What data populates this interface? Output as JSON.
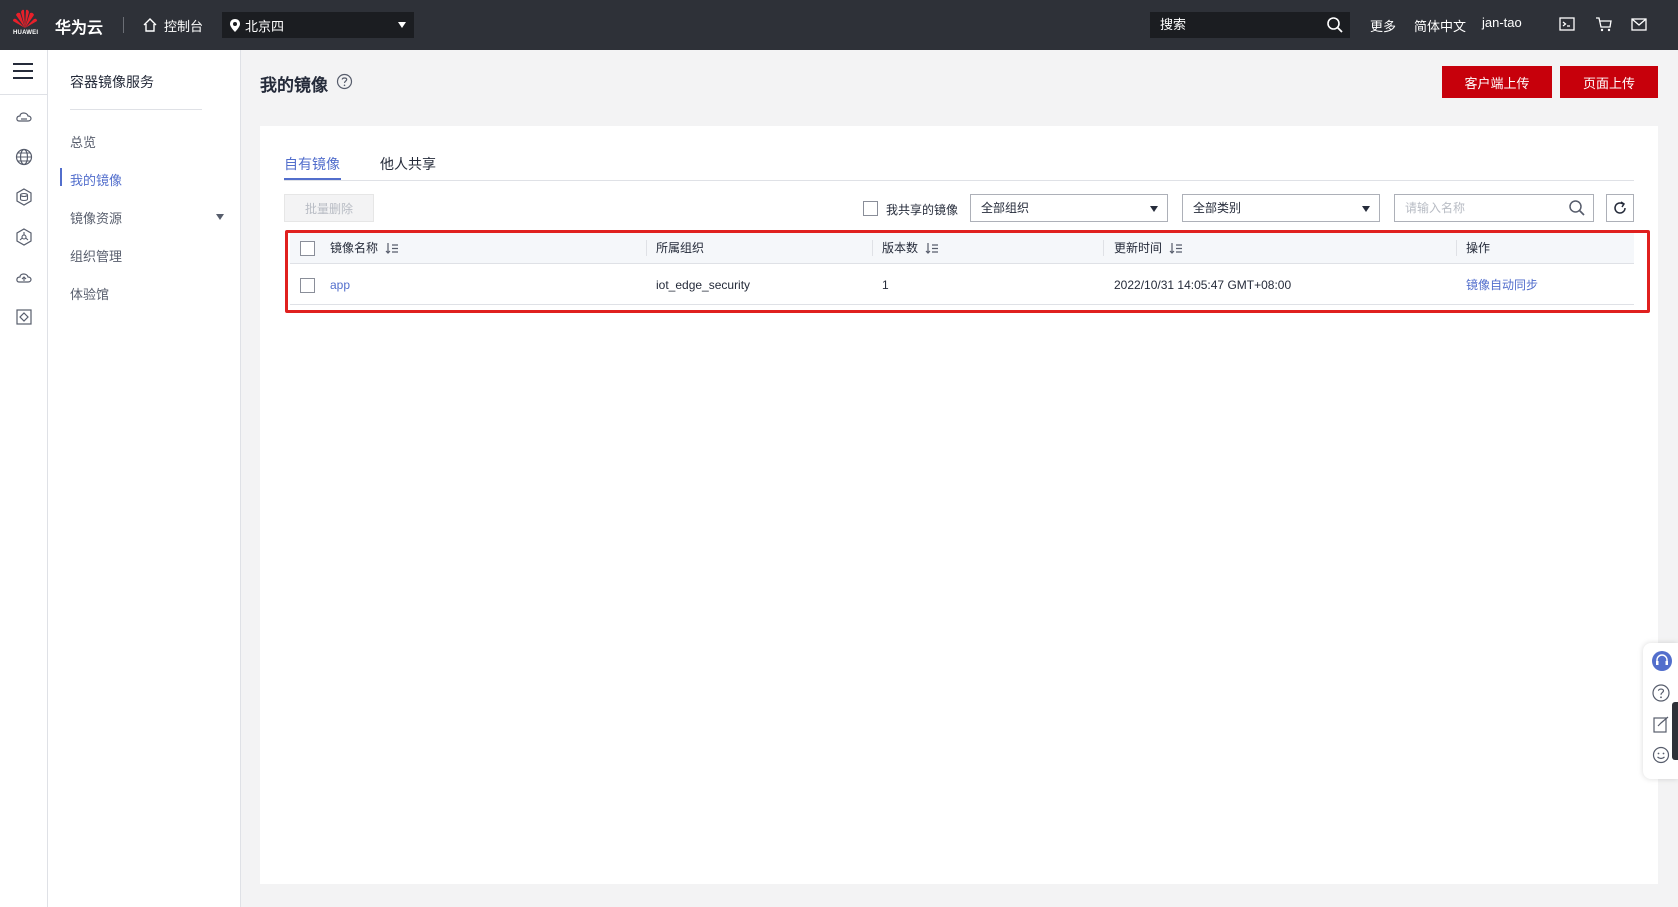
{
  "topbar": {
    "logo_text": "HUAWEI",
    "brand": "华为云",
    "console_label": "控制台",
    "region": "北京四",
    "search_placeholder": "搜索",
    "more": "更多",
    "language": "简体中文",
    "username": "jan-tao",
    "icons": [
      "terminal-icon",
      "cart-icon",
      "mail-icon"
    ]
  },
  "sidebar": {
    "service_title": "容器镜像服务",
    "items": [
      {
        "label": "总览"
      },
      {
        "label": "我的镜像",
        "active": true
      },
      {
        "label": "镜像资源",
        "expandable": true
      },
      {
        "label": "组织管理"
      },
      {
        "label": "体验馆"
      }
    ]
  },
  "main": {
    "title": "我的镜像",
    "buttons": {
      "client_upload": "客户端上传",
      "page_upload": "页面上传"
    },
    "tabs": [
      {
        "label": "自有镜像",
        "active": true
      },
      {
        "label": "他人共享"
      }
    ],
    "toolbar": {
      "batch_delete": "批量删除",
      "shared_by_me": "我共享的镜像",
      "org_select": "全部组织",
      "type_select": "全部类别",
      "name_placeholder": "请输入名称"
    },
    "table": {
      "columns": [
        "镜像名称",
        "所属组织",
        "版本数",
        "更新时间",
        "操作"
      ],
      "rows": [
        {
          "name": "app",
          "organization": "iot_edge_security",
          "versions": "1",
          "updated": "2022/10/31 14:05:47 GMT+08:00",
          "action": "镜像自动同步"
        }
      ]
    }
  },
  "colors": {
    "topbar": "#2e3138",
    "brand_red": "#c7000b",
    "link_blue": "#526ecc",
    "highlight_red": "#e0201f"
  }
}
